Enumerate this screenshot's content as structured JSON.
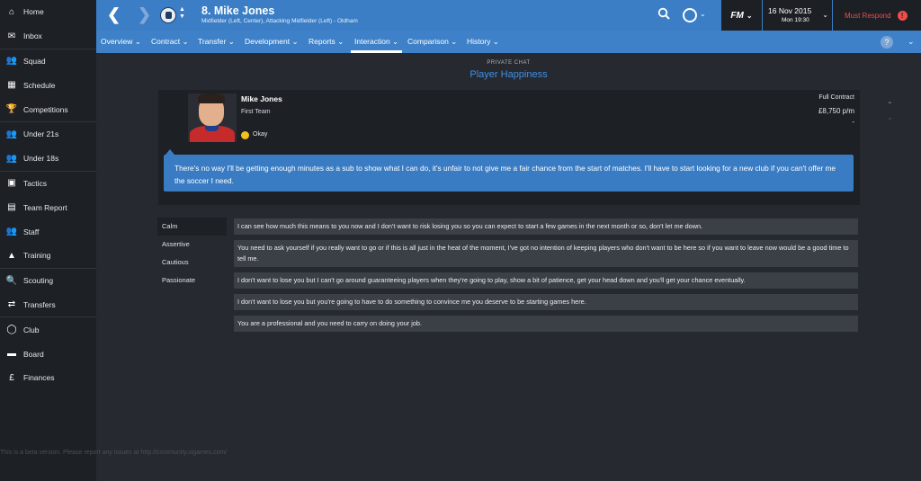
{
  "sidebar": {
    "items": [
      {
        "label": "Home",
        "icon": "home-icon",
        "glyph": "⌂"
      },
      {
        "label": "Inbox",
        "icon": "inbox-icon",
        "glyph": "✉"
      },
      {
        "label": "Squad",
        "icon": "squad-icon",
        "glyph": "👥"
      },
      {
        "label": "Schedule",
        "icon": "schedule-icon",
        "glyph": "▦"
      },
      {
        "label": "Competitions",
        "icon": "trophy-icon",
        "glyph": "🏆"
      },
      {
        "label": "Under 21s",
        "icon": "under21-icon",
        "glyph": "👥"
      },
      {
        "label": "Under 18s",
        "icon": "under18-icon",
        "glyph": "👥"
      },
      {
        "label": "Tactics",
        "icon": "tactics-icon",
        "glyph": "▣"
      },
      {
        "label": "Team Report",
        "icon": "report-icon",
        "glyph": "▤"
      },
      {
        "label": "Staff",
        "icon": "staff-icon",
        "glyph": "👥"
      },
      {
        "label": "Training",
        "icon": "training-icon",
        "glyph": "▲"
      },
      {
        "label": "Scouting",
        "icon": "scouting-icon",
        "glyph": "🔍"
      },
      {
        "label": "Transfers",
        "icon": "transfers-icon",
        "glyph": "⇄"
      },
      {
        "label": "Club",
        "icon": "club-icon",
        "glyph": "◯"
      },
      {
        "label": "Board",
        "icon": "board-icon",
        "glyph": "▬"
      },
      {
        "label": "Finances",
        "icon": "finances-icon",
        "glyph": "£"
      }
    ]
  },
  "header": {
    "player_title": "8. Mike Jones",
    "player_subtitle": "Midfielder (Left, Center), Attacking Midfielder (Left) - Oldham",
    "fm_label": "FM",
    "date": "16 Nov 2015",
    "day_time": "Mon 19:30",
    "must_respond": "Must Respond",
    "alert_glyph": "!"
  },
  "tabs": [
    {
      "label": "Overview ⌄",
      "active": false
    },
    {
      "label": "Contract ⌄",
      "active": false
    },
    {
      "label": "Transfer ⌄",
      "active": false
    },
    {
      "label": "Development ⌄",
      "active": false
    },
    {
      "label": "Reports ⌄",
      "active": false
    },
    {
      "label": "Interaction ⌄",
      "active": true
    },
    {
      "label": "Comparison ⌄",
      "active": false
    },
    {
      "label": "History ⌄",
      "active": false
    }
  ],
  "page": {
    "kicker": "PRIVATE CHAT",
    "title": "Player Happiness"
  },
  "card": {
    "name": "Mike Jones",
    "team": "First Team",
    "mood": "Okay",
    "contract_type": "Full Contract",
    "wage": "£8,750 p/m",
    "dash": "-",
    "message": "There's no way I'll be getting enough minutes as a sub to show what I can do, it's unfair to not give me a fair chance from the start of matches. I'll have to start looking for a new club if you can't offer me the soccer I need."
  },
  "tones": [
    "Calm",
    "Assertive",
    "Cautious",
    "Passionate"
  ],
  "responses": [
    "I can see how much this means to you now and I don't want to risk losing you so you can expect to start a few games in the next month or so, don't let me down.",
    "You need to ask yourself if you really want to go or if this is all just in the heat of the moment, I've got no intention of keeping players who don't want to be here so if you want to leave now would be a good time to tell me.",
    "I don't want to lose you but I can't go around guaranteeing players when they're going to play, show a bit of patience, get your head down and you'll get your chance eventually.",
    "I don't want to lose you but you're going to have to do something to convince me you deserve to be starting games here.",
    "You are a professional and you need to carry on doing your job."
  ],
  "footer": "This is a beta version. Please report any issues at http://community.sigames.com/",
  "colors": {
    "accent": "#3b7ec6",
    "sidebar_bg": "#1d2025",
    "content_bg": "#262a30",
    "alert": "#ef4c4c",
    "mood_dot": "#f2c21b"
  }
}
